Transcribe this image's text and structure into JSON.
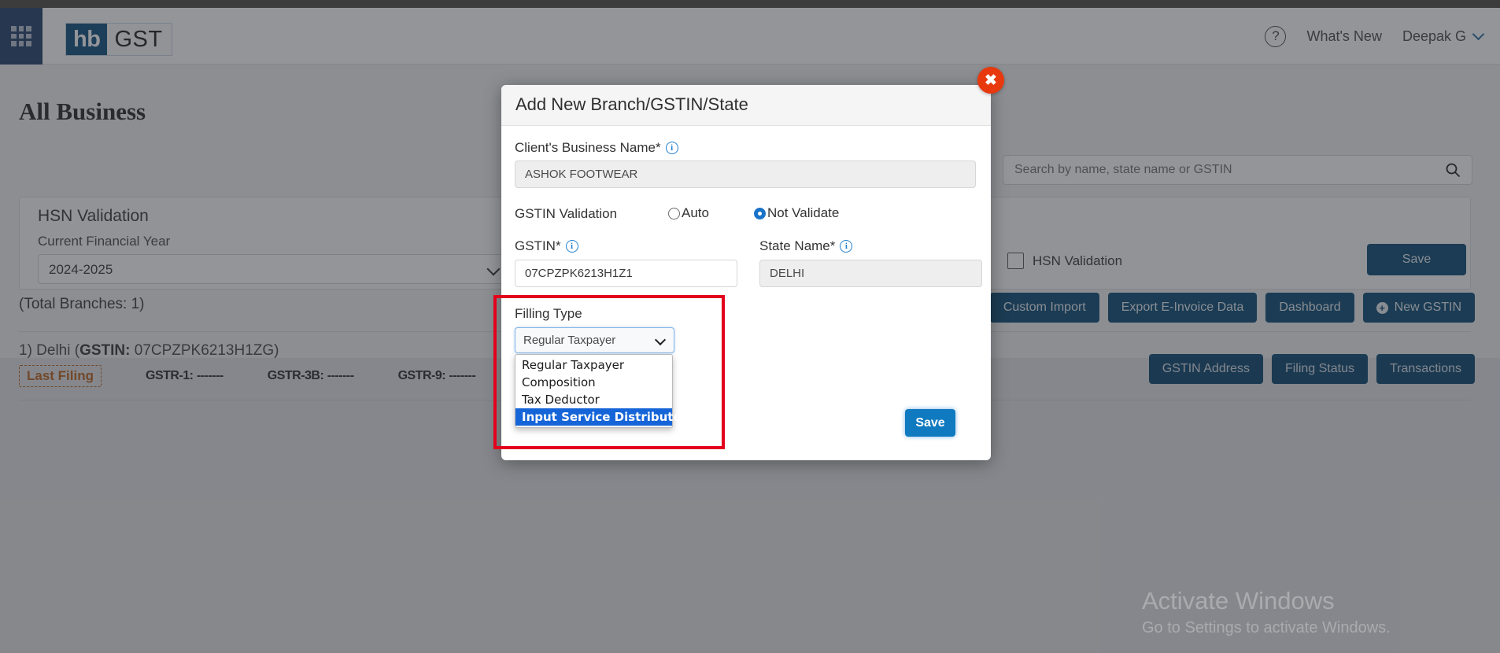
{
  "header": {
    "logo_hb": "hb",
    "logo_gst": "GST",
    "grid_icon": "grid-apps-icon",
    "help_icon": "?",
    "whats_new": "What's New",
    "user_name": "Deepak G",
    "chevron_icon": "chevron-down-icon"
  },
  "page": {
    "title": "All Business",
    "branch_count": "(Total Branches: 1)",
    "branch_entry": "1) Delhi (",
    "branch_gstin_label": "GSTIN:",
    "branch_gstin_value": " 07CPZPK6213H1ZG)"
  },
  "search": {
    "placeholder": "Search by name, state name or GSTIN",
    "value": "",
    "icon": "search-icon"
  },
  "hsn_card": {
    "title": "HSN Validation",
    "fy_label": "Current Financial Year",
    "fy_value": "2024-2025",
    "fy_options": [
      "2024-2025"
    ],
    "checkbox_label": "HSN Validation",
    "checkbox_checked": false,
    "save_label": "Save"
  },
  "action_buttons": [
    {
      "label": "Custom Import",
      "icon": ""
    },
    {
      "label": "Export E-Invoice Data",
      "icon": ""
    },
    {
      "label": "Dashboard",
      "icon": ""
    },
    {
      "label": "New GSTIN",
      "icon": "plus-circle-icon"
    }
  ],
  "branch_buttons": [
    {
      "label": "GSTIN Address"
    },
    {
      "label": "Filing Status"
    },
    {
      "label": "Transactions"
    }
  ],
  "filing": {
    "last_filing": "Last Filing",
    "items": [
      {
        "label": "GSTR-1:",
        "value": "-------"
      },
      {
        "label": "GSTR-3B:",
        "value": "-------"
      },
      {
        "label": "GSTR-9:",
        "value": "-------"
      }
    ]
  },
  "modal": {
    "title": "Add New Branch/GSTIN/State",
    "close_icon": "✖",
    "business_name_label": "Client's Business Name*",
    "business_name_value": "ASHOK FOOTWEAR",
    "business_name_placeholder": "",
    "info_icon": "i",
    "validation_label": "GSTIN Validation",
    "radio_auto": "Auto",
    "radio_not_validate": "Not Validate",
    "radio_selected": "Not Validate",
    "gstin_label": "GSTIN*",
    "gstin_value": "07CPZPK6213H1Z1",
    "gstin_placeholder": "",
    "state_label": "State Name*",
    "state_value": "DELHI",
    "state_placeholder": "",
    "filling_type_label": "Filling Type",
    "filling_type_value": "Regular Taxpayer",
    "filling_type_options": [
      "Regular Taxpayer",
      "Composition",
      "Tax Deductor",
      "Input Service Distributor"
    ],
    "filling_type_highlighted": "Input Service Distributor",
    "save_label": "Save"
  },
  "watermark": {
    "line1": "Activate Windows",
    "line2": "Go to Settings to activate Windows."
  },
  "colors": {
    "brand_navy": "#0f4c75",
    "logo_navy": "#12507f",
    "accent_blue": "#0f7ac0",
    "close_red": "#e8380d",
    "annotation_red": "#e3001b",
    "last_filing_orange": "#c96a20",
    "option_highlight": "#1565d8"
  }
}
